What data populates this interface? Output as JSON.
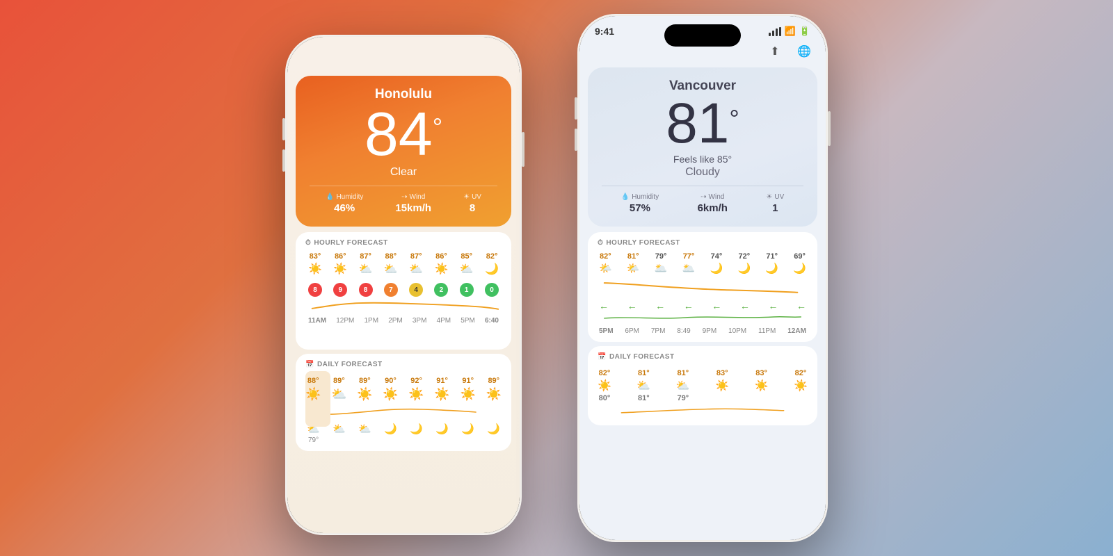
{
  "background": {
    "gradient": "linear-gradient(135deg, #e8523a, #e07040, #c8b8c0, #8ab0d0)"
  },
  "phone_left": {
    "city": "Honolulu",
    "temperature": "84",
    "degree_symbol": "°",
    "condition": "Clear",
    "humidity_label": "Humidity",
    "humidity_value": "46%",
    "wind_label": "Wind",
    "wind_value": "15km/h",
    "uv_label": "UV",
    "uv_value": "8",
    "hourly_forecast_label": "HOURLY FORECAST",
    "hourly_items": [
      {
        "time": "11AM",
        "temp": "83°",
        "icon": "☀️",
        "uv": "8",
        "uv_level": "high"
      },
      {
        "time": "12PM",
        "temp": "86°",
        "icon": "☀️",
        "uv": "9",
        "uv_level": "high"
      },
      {
        "time": "1PM",
        "temp": "87°",
        "icon": "⛅",
        "uv": "8",
        "uv_level": "high"
      },
      {
        "time": "2PM",
        "temp": "88°",
        "icon": "⛅",
        "uv": "7",
        "uv_level": "med"
      },
      {
        "time": "3PM",
        "temp": "87°",
        "icon": "⛅",
        "uv": "4",
        "uv_level": "med"
      },
      {
        "time": "4PM",
        "temp": "86°",
        "icon": "☀️",
        "uv": "2",
        "uv_level": "low"
      },
      {
        "time": "5PM",
        "temp": "85°",
        "icon": "⛅",
        "uv": "1",
        "uv_level": "low"
      },
      {
        "time": "6:40",
        "temp": "82°",
        "icon": "🌙",
        "uv": "0",
        "uv_level": "zero"
      }
    ],
    "daily_forecast_label": "DAILY FORECAST",
    "daily_items": [
      {
        "temp": "88°",
        "icon": "☀️"
      },
      {
        "temp": "89°",
        "icon": "⛅"
      },
      {
        "temp": "89°",
        "icon": "☀️"
      },
      {
        "temp": "90°",
        "icon": "☀️"
      },
      {
        "temp": "92°",
        "icon": "☀️"
      },
      {
        "temp": "91°",
        "icon": "☀️"
      },
      {
        "temp": "91°",
        "icon": "☀️"
      },
      {
        "temp": "89°",
        "icon": "☀️"
      }
    ]
  },
  "phone_right": {
    "status_time": "9:41",
    "city": "Vancouver",
    "temperature": "81",
    "degree_symbol": "°",
    "feels_like": "Feels like 85°",
    "condition": "Cloudy",
    "humidity_label": "Humidity",
    "humidity_value": "57%",
    "wind_label": "Wind",
    "wind_value": "6km/h",
    "uv_label": "UV",
    "uv_value": "1",
    "hourly_forecast_label": "HOURLY FORECAST",
    "hourly_items": [
      {
        "time": "5PM",
        "temp": "82°",
        "icon": "🌤️",
        "warm": true
      },
      {
        "time": "6PM",
        "temp": "81°",
        "icon": "🌤️",
        "warm": true
      },
      {
        "time": "7PM",
        "temp": "79°",
        "icon": "🌥️",
        "warm": false
      },
      {
        "time": "8:49",
        "temp": "77°",
        "icon": "🌥️",
        "warm": false
      },
      {
        "time": "9PM",
        "temp": "74°",
        "icon": "🌙",
        "warm": false
      },
      {
        "time": "10PM",
        "temp": "72°",
        "icon": "🌙",
        "warm": false
      },
      {
        "time": "11PM",
        "temp": "71°",
        "icon": "🌙",
        "warm": false
      },
      {
        "time": "12AM",
        "temp": "69°",
        "icon": "🌙",
        "warm": false
      }
    ],
    "wind_arrows": [
      "←",
      "←",
      "←",
      "←",
      "←",
      "←",
      "←",
      "←"
    ],
    "daily_forecast_label": "DAILY FORECAST",
    "daily_items": [
      {
        "high": "82°",
        "low": "80°",
        "icon": "☀️"
      },
      {
        "high": "81°",
        "low": "81°",
        "icon": "⛅"
      },
      {
        "high": "81°",
        "low": "79°",
        "icon": "⛅"
      },
      {
        "high": "83°",
        "low": "",
        "icon": "☀️"
      },
      {
        "high": "83°",
        "low": "",
        "icon": "☀️"
      },
      {
        "high": "82°",
        "low": "",
        "icon": "☀️"
      }
    ],
    "share_btn": "↑",
    "globe_btn": "🌐"
  }
}
